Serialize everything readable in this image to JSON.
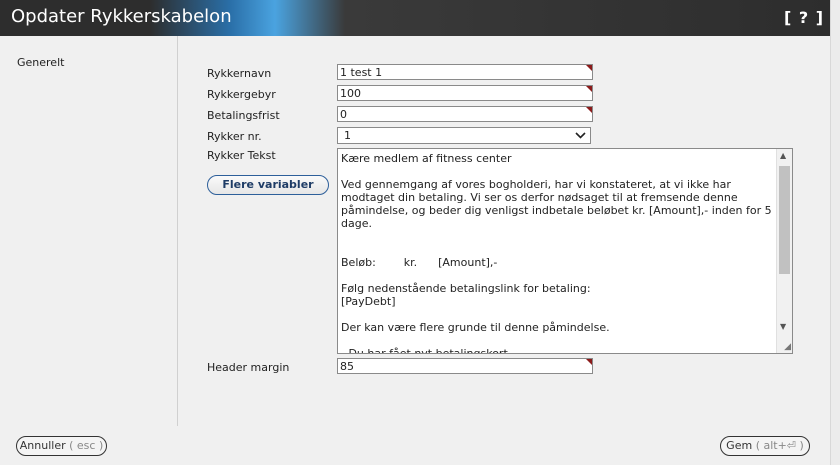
{
  "window": {
    "title": "Opdater Rykkerskabelon",
    "help_label": "[ ? ]"
  },
  "nav": {
    "items": [
      {
        "label": "Generelt"
      }
    ]
  },
  "form": {
    "name": {
      "label": "Rykkernavn",
      "value": "1 test 1"
    },
    "fee": {
      "label": "Rykkergebyr",
      "value": "100"
    },
    "deadline": {
      "label": "Betalingsfrist",
      "value": "0"
    },
    "reminder_no": {
      "label": "Rykker nr.",
      "selected": "1"
    },
    "text": {
      "label": "Rykker Tekst",
      "value": "Kære medlem af fitness center\n\nVed gennemgang af vores bogholderi, har vi konstateret, at vi ikke har modtaget din betaling. Vi ser os derfor nødsaget til at fremsende denne påmindelse, og beder dig venligst indbetale beløbet kr. [Amount],- inden for 5 dage.\n\n\nBeløb:        kr.      [Amount],-\n\nFølg nedenstående betalingslink for betaling:\n[PayDebt]\n\nDer kan være flere grunde til denne påmindelse.\n\n- Du har fået nyt betalingskort.\n- Du har skiftet bank og derved betalingskort."
    },
    "more_variables_label": "Flere variabler",
    "header_margin": {
      "label": "Header margin",
      "value": "85"
    }
  },
  "footer": {
    "cancel": {
      "label": "Annuller",
      "shortcut": "( esc )"
    },
    "save": {
      "label": "Gem",
      "shortcut": "( alt+⏎ )"
    }
  },
  "colors": {
    "accent_blue": "#4aa3e0",
    "titlebar": "#2d2d2d",
    "required_marker": "#8b1a1a"
  }
}
